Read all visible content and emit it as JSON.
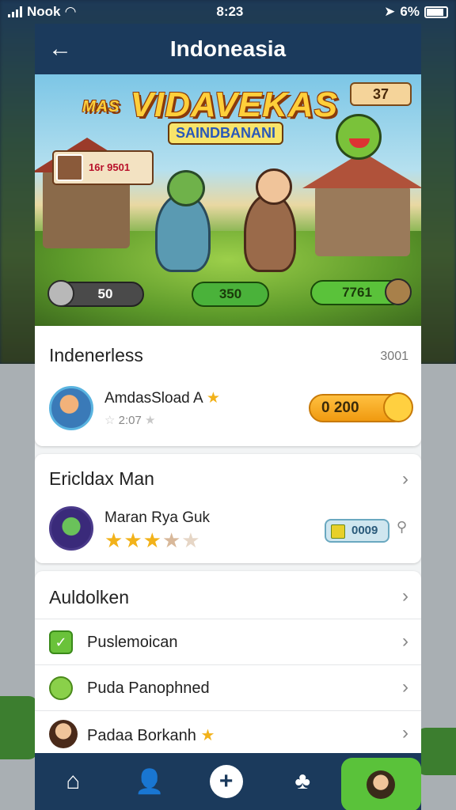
{
  "status_bar": {
    "carrier": "Nook",
    "time": "8:23",
    "battery": "6%"
  },
  "header": {
    "title": "Indoneasia"
  },
  "banner": {
    "logo": "VIDAVEKAS",
    "logo_small": "MAS",
    "logo_sub": "SAINDBANANI",
    "top_badge": "37",
    "player_card": "16r 9501",
    "pill_left": "50",
    "pill_center": "350",
    "pill_right": "7761"
  },
  "section1": {
    "title": "Indenerless",
    "meta": "3001",
    "player": {
      "name": "AmdasSload A",
      "sub": "2:07",
      "button": "0 200"
    }
  },
  "section2": {
    "title": "Ericldax Man",
    "player": {
      "name": "Maran Rya Guk",
      "chip": "0009",
      "rating": 3
    }
  },
  "section3": {
    "title": "Auldolken",
    "rows": [
      {
        "label": "Puslemoican"
      },
      {
        "label": "Puda Panophned"
      },
      {
        "label": "Padaa Borkanh"
      }
    ]
  },
  "tabbar": {
    "active": "profile"
  }
}
